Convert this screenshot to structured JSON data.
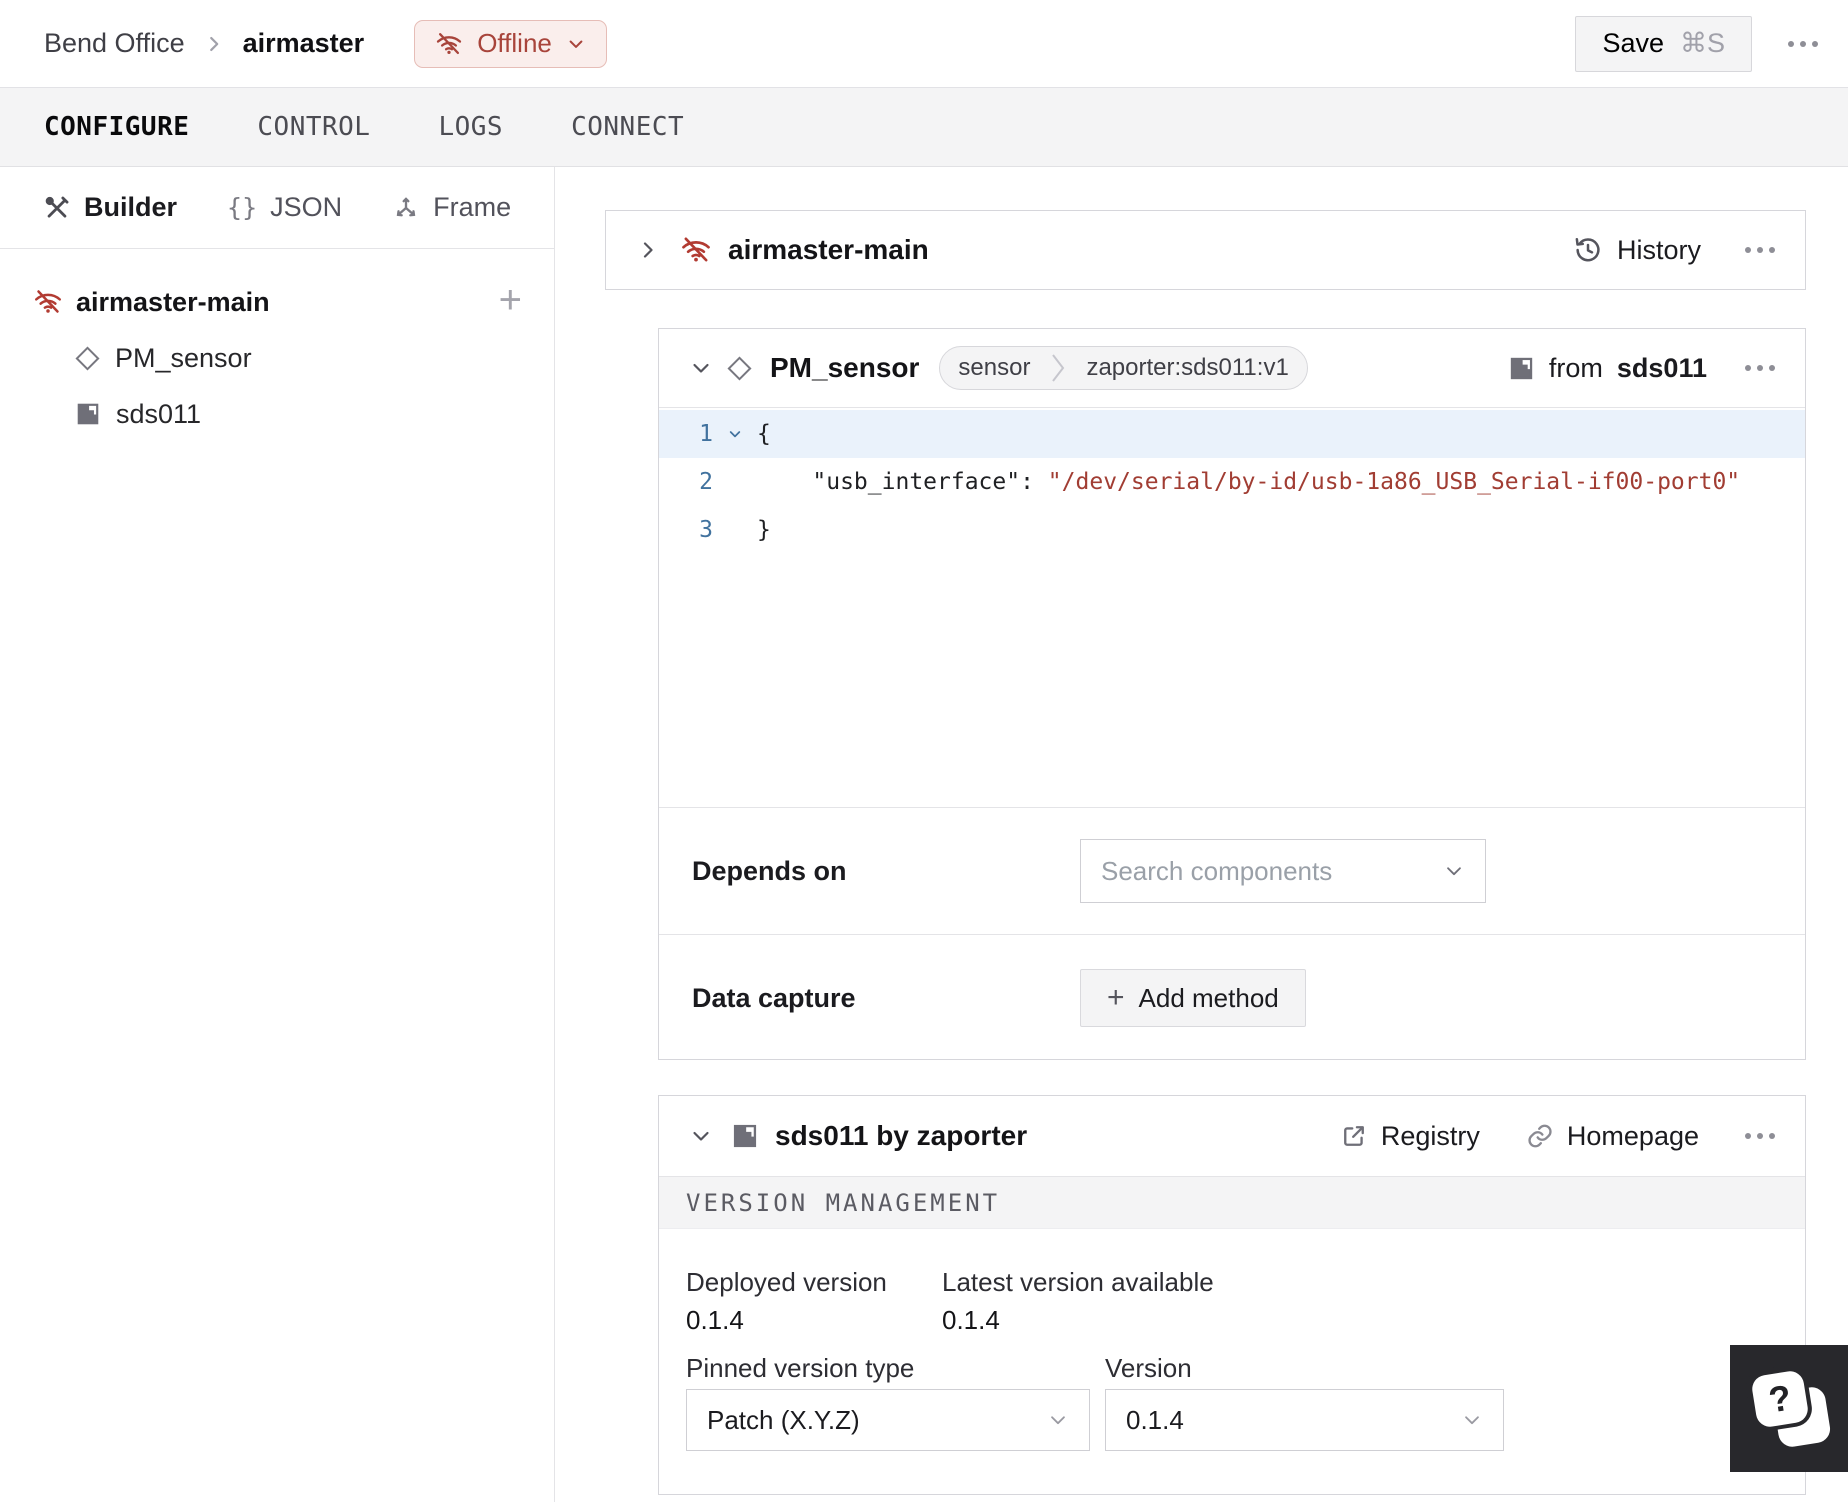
{
  "header": {
    "breadcrumb": {
      "org": "Bend Office",
      "machine": "airmaster"
    },
    "status": {
      "label": "Offline"
    },
    "save": {
      "label": "Save",
      "shortcut": "⌘S"
    }
  },
  "tabs": [
    {
      "label": "CONFIGURE",
      "active": true
    },
    {
      "label": "CONTROL"
    },
    {
      "label": "LOGS"
    },
    {
      "label": "CONNECT"
    }
  ],
  "sidebar": {
    "modes": [
      {
        "label": "Builder",
        "active": true
      },
      {
        "label": "JSON"
      },
      {
        "label": "Frame"
      }
    ],
    "tree": {
      "root": "airmaster-main",
      "children": [
        {
          "label": "PM_sensor"
        },
        {
          "label": "sds011"
        }
      ]
    }
  },
  "part_card": {
    "title": "airmaster-main",
    "history_label": "History"
  },
  "component_card": {
    "name": "PM_sensor",
    "type_badge": "sensor",
    "model_badge": "zaporter:sds011:v1",
    "from_label": "from",
    "from_module": "sds011",
    "code": {
      "line1_num": "1",
      "line1_text": "{",
      "line2_num": "2",
      "line2_key": "    \"usb_interface\":",
      "line2_value": " \"/dev/serial/by-id/usb-1a86_USB_Serial-if00-port0\"",
      "line3_num": "3",
      "line3_text": "}"
    },
    "depends_on": {
      "label": "Depends on",
      "placeholder": "Search components"
    },
    "data_capture": {
      "label": "Data capture",
      "button_label": "Add method"
    }
  },
  "module_card": {
    "title": "sds011 by zaporter",
    "registry_label": "Registry",
    "homepage_label": "Homepage",
    "section_title": "VERSION MANAGEMENT",
    "deployed_label": "Deployed version",
    "deployed_value": "0.1.4",
    "latest_label": "Latest version available",
    "latest_value": "0.1.4",
    "pinned_label": "Pinned version type",
    "pinned_value": "Patch (X.Y.Z)",
    "version_label": "Version",
    "version_value": "0.1.4"
  },
  "help": {
    "glyph": "?"
  },
  "colors": {
    "accent_red": "#b23b32",
    "chip_bg": "#faeeec",
    "code_string": "#a13d33",
    "line_number_blue": "#41729e",
    "card_border": "#d6d6db",
    "gray_bg": "#f4f4f5"
  }
}
